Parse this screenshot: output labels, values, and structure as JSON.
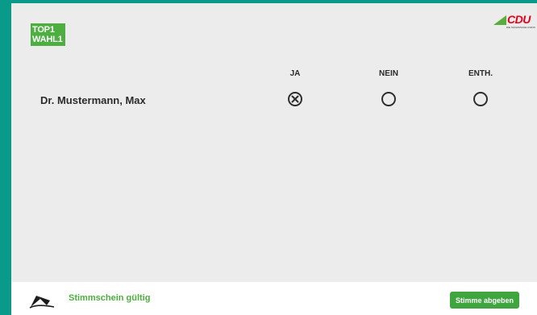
{
  "ballot": {
    "badge_line1": "TOP1",
    "badge_line2": "WAHL1"
  },
  "logo": {
    "name": "CDU",
    "subtitle": "DIE SÄCHSISCHE UNION",
    "colors": {
      "brand_red": "#e2001a",
      "brand_green": "#58ad3c"
    }
  },
  "columns": [
    "JA",
    "NEIN",
    "ENTH."
  ],
  "candidates": [
    {
      "name": "Dr. Mustermann, Max",
      "selected": "JA"
    }
  ],
  "footer": {
    "status": "Stimmschein gültig",
    "submit_label": "Stimme abgeben"
  },
  "colors": {
    "background": "#0a9a8a",
    "panel": "#ececed",
    "accent_green": "#4caf3f"
  }
}
